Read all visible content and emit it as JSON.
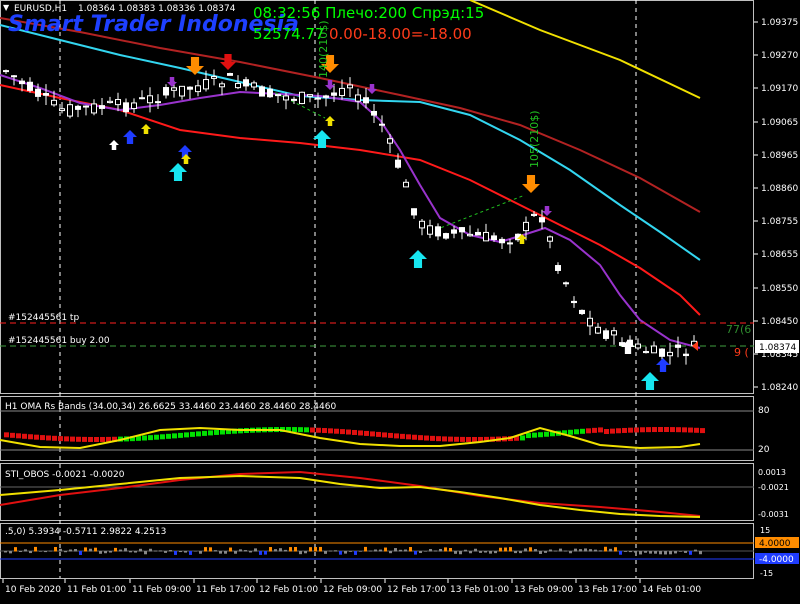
{
  "header": {
    "symbol_tf": "EURUSD,H1",
    "ohlc": "1.08364 1.08383 1.08336 1.08374",
    "brand": "Smart Trader Indonesia",
    "clock_line": "08:32:56 Плечо:200 Спрэд:15",
    "account_line_a": "52574.77",
    "account_line_b": "0.00-18.00=-18.00",
    "vertical_label_1": "140(210$)",
    "vertical_label_2": "105(210$)"
  },
  "price_axis": {
    "ticks": [
      "1.09375",
      "1.09270",
      "1.09170",
      "1.09065",
      "1.08965",
      "1.08860",
      "1.08755",
      "1.08655",
      "1.08550",
      "1.08450",
      "1.08345",
      "1.08240"
    ],
    "current_price": "1.08374"
  },
  "order_lines": {
    "tp_label": "#152445561 tp",
    "buy_label": "#152445561 buy 2.00",
    "tp_right": "77(6",
    "buy_right": "9 ("
  },
  "panels": [
    {
      "title": "H1 OMA Rs Bands (34.00,34) 26.6625 33.4460 23.4460 28.4460 28.4460",
      "levels": [
        "80",
        "20"
      ]
    },
    {
      "title": "STI_OBOS -0.0021 -0.0020",
      "levels": [
        "0.0013",
        "-0.0021",
        "-0.0020",
        "-0.0031"
      ]
    },
    {
      "title": ".5,0) 5.3934 -0.5711 2.9822 4.2513",
      "levels": [
        "15",
        "4.0000",
        "-4.0000",
        "-15"
      ]
    }
  ],
  "time_axis": [
    "10 Feb 2020",
    "11 Feb 01:00",
    "11 Feb 09:00",
    "11 Feb 17:00",
    "12 Feb 01:00",
    "12 Feb 09:00",
    "12 Feb 17:00",
    "13 Feb 01:00",
    "13 Feb 09:00",
    "13 Feb 17:00",
    "14 Feb 01:00"
  ],
  "colors": {
    "bg": "#000000",
    "up_candle": "#ffffff",
    "down_candle": "#000000",
    "ma_yellow": "#f0e000",
    "ma_brown": "#b22222",
    "ma_red": "#ff1a1a",
    "ma_cyan": "#33d6f0",
    "ma_purple": "#9933cc",
    "arrow_orange": "#ff8c00",
    "arrow_cyan": "#17e6f0",
    "arrow_blue": "#1f3cff",
    "brand_blue": "#1e40ff",
    "text_green": "#00ff00",
    "text_red": "#ff3b1a"
  }
}
